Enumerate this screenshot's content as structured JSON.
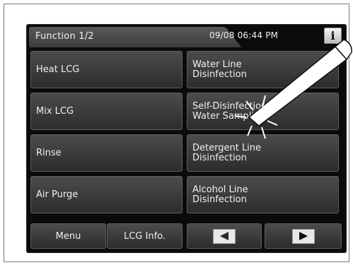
{
  "header": {
    "title": "Function 1/2",
    "datetime": "09/08 06:44 PM",
    "info_label": "i"
  },
  "buttons": {
    "heat_lcg": "Heat LCG",
    "mix_lcg": "Mix LCG",
    "rinse": "Rinse",
    "air_purge": "Air Purge",
    "water_line": [
      "Water Line",
      "Disinfection"
    ],
    "self_disinfection": [
      "Self-Disinfection &",
      "Water Sampling"
    ],
    "detergent_line": [
      "Detergent Line",
      "Disinfection"
    ],
    "alcohol_line": [
      "Alcohol Line",
      "Disinfection"
    ]
  },
  "footer": {
    "menu": "Menu",
    "lcg_info": "LCG Info.",
    "prev_icon": "left-triangle-icon",
    "next_icon": "right-triangle-icon"
  },
  "colors": {
    "screen_bg": "#0b0b0b",
    "button_top": "#4c4c4c",
    "button_bottom": "#2c2c2c",
    "text": "#f0f0f0"
  }
}
